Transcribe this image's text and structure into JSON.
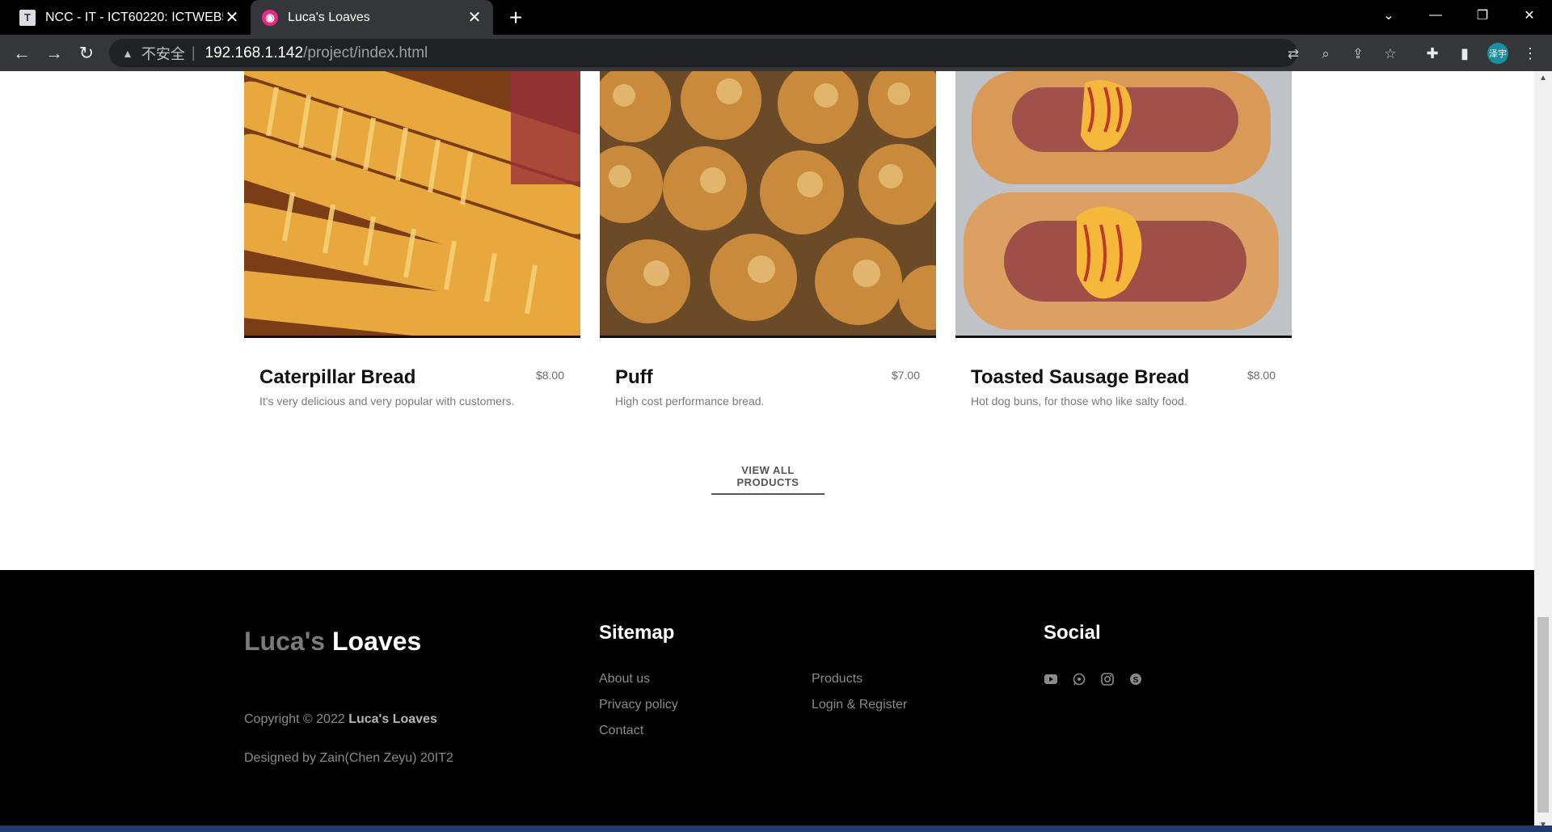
{
  "browser": {
    "tabs": [
      {
        "title": "NCC - IT - ICT60220: ICTWEB5",
        "favicon": "T"
      },
      {
        "title": "Luca's Loaves",
        "favicon": "loaves-logo"
      }
    ],
    "address": {
      "security_label": "不安全",
      "url_host": "192.168.1.142",
      "url_path": "/project/index.html"
    },
    "profile_label": "泽宇"
  },
  "products": [
    {
      "name": "Caterpillar Bread",
      "price": "$8.00",
      "description": "It's very delicious and very popular with customers.",
      "image": "caterpillar-bread-photo"
    },
    {
      "name": "Puff",
      "price": "$7.00",
      "description": "High cost performance bread.",
      "image": "puff-bread-photo"
    },
    {
      "name": "Toasted Sausage Bread",
      "price": "$8.00",
      "description": "Hot dog buns, for those who like salty food.",
      "image": "sausage-bread-photo"
    }
  ],
  "view_all_label": "VIEW ALL PRODUCTS",
  "footer": {
    "brand_part1": "Luca's",
    "brand_part2": "Loaves",
    "copyright_prefix": "Copyright © 2022",
    "copyright_brand": "Luca's Loaves",
    "designed_by": "Designed by Zain(Chen Zeyu) 20IT2",
    "sitemap_title": "Sitemap",
    "sitemap_links": [
      "About us",
      "Privacy policy",
      "Contact",
      "Products",
      "Login & Register"
    ],
    "social_title": "Social",
    "social_icons": [
      "youtube-icon",
      "whatsapp-icon",
      "instagram-icon",
      "skype-icon"
    ]
  },
  "colors": {
    "footer_bg": "#000000",
    "brand_muted": "#7a7a7a",
    "tab_active": "#35363a"
  }
}
